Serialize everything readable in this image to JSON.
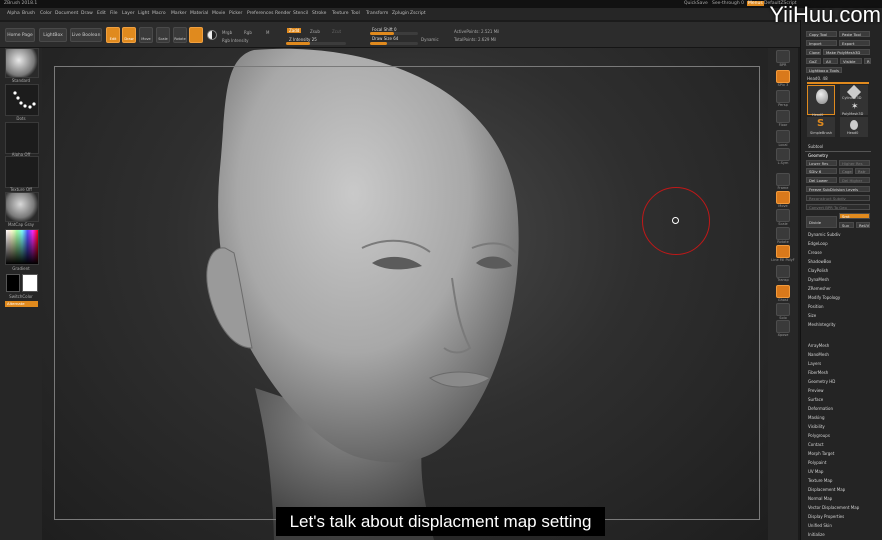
{
  "app": {
    "title": "ZBrush 2018.1",
    "title_right": [
      "QuickSave",
      "See-through 0",
      "Menus",
      "DefaultZScript"
    ]
  },
  "menu": [
    "Alpha",
    "Brush",
    "Color",
    "Document",
    "Draw",
    "Edit",
    "File",
    "Layer",
    "Light",
    "Macro",
    "Marker",
    "Material",
    "Movie",
    "Picker",
    "Preferences",
    "Render",
    "Stencil",
    "Stroke",
    "Texture",
    "Tool",
    "Transform",
    "Zplugin",
    "Zscript"
  ],
  "toolbar": {
    "home_page": "Home Page",
    "lightbox": "LightBox",
    "live_boolean": "Live Boolean",
    "edit": "Edit",
    "draw": "Draw",
    "move": "Move",
    "scale": "Scale",
    "rotate": "Rotate",
    "mrgb": "Mrgb",
    "rgb": "Rgb",
    "m": "M",
    "zadd": "Zadd",
    "zsub": "Zsub",
    "zcut": "Zcut",
    "rgb_intensity": "Rgb Intensity",
    "z_intensity": "Z Intensity 25",
    "focal_shift": "Focal Shift 0",
    "draw_size": "Draw Size 64",
    "dynamic": "Dynamic",
    "active_points": "ActivePoints: 2.521 Mil",
    "total_points": "TotalPoints: 2.629 Mil"
  },
  "left_shelf": {
    "brush": "Standard",
    "stroke": "Dots",
    "alpha": "Alpha Off",
    "texture": "Texture Off",
    "material": "MatCap Gray",
    "gradient": "Gradient",
    "switch_color": "SwitchColor",
    "alternate": "Alternate"
  },
  "right_shelf": [
    "BPR",
    "SPix 3",
    "Persp",
    "Floor",
    "Local",
    "L.Sym",
    "Frame",
    "Move",
    "Scale",
    "Rotate",
    "Line Fill PolyF",
    "Transp",
    "Ghost",
    "Solo",
    "Xpose"
  ],
  "tray": {
    "top_buttons": [
      "Copy Tool",
      "Paste Tool",
      "Import",
      "Export",
      "Clone",
      "Make PolyMesh3D",
      "GoZ",
      "All",
      "Visible",
      "R"
    ],
    "lightbox_tools": "Lightbox ▸ Tools",
    "head_label": "Head0. 48",
    "tools": [
      "Head0",
      "Cylinder3D",
      "SimpleBrush",
      "PolyMesh3D",
      "Head0"
    ],
    "subtool": "Subtool",
    "geometry": "Geometry",
    "lower_res": "Lower Res",
    "higher_res": "Higher Res",
    "sdiv": "SDiv 6",
    "cage": "Cage",
    "rstr": "Rstr",
    "del_lower": "Del Lower",
    "del_higher": "Del Higher",
    "freeze": "Freeze SubDivision Levels",
    "reconstruct": "Reconstruct Subdiv",
    "convert": "Convert BPR To Geo",
    "divide": "Divide",
    "smt": "Smt",
    "suv": "Suv",
    "reuv": "ReUV",
    "geo_items": [
      "Dynamic Subdiv",
      "EdgeLoop",
      "Crease",
      "ShadowBox",
      "ClayPolish",
      "DynaMesh",
      "ZRemesher",
      "Modify Topology",
      "Position",
      "Size",
      "MeshIntegrity"
    ],
    "sub_items": [
      "ArrayMesh",
      "NanoMesh",
      "Layers",
      "FiberMesh",
      "Geometry HD",
      "Preview",
      "Surface",
      "Deformation",
      "Masking",
      "Visibility",
      "Polygroups",
      "Contact",
      "Morph Target",
      "Polypaint",
      "UV Map",
      "Texture Map",
      "Displacement Map",
      "Normal Map",
      "Vector Displacement Map",
      "Display Properties",
      "Unified Skin",
      "Initialize"
    ]
  },
  "watermark": "YiiHuu.com",
  "caption": "Let's talk about displacment map setting",
  "colors": {
    "accent": "#e08a1e",
    "cursor": "#c01818"
  }
}
